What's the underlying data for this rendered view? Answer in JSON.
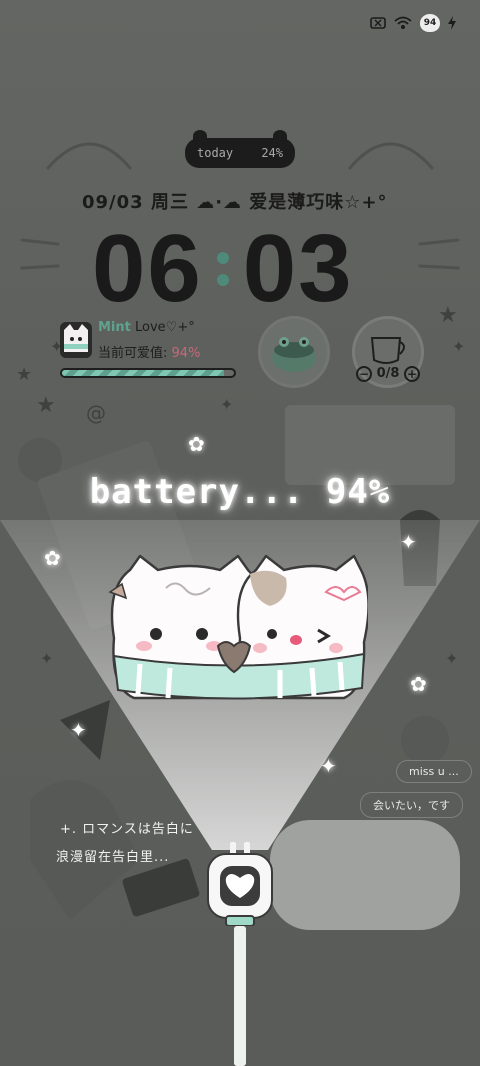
{
  "status_bar": {
    "icons": [
      "no-sim-icon",
      "wifi-icon",
      "battery-cat-icon",
      "charging-bolt-icon"
    ],
    "battery_level": "94"
  },
  "widget": {
    "today_label": "today",
    "today_percent": "24%",
    "date_line": "09/03 周三 ☁·☁ 爱是薄巧味☆+°",
    "time_hours": "06",
    "time_minutes": "03",
    "mint_name": "Mint",
    "mint_suffix": "Love♡+°",
    "cute_label": "当前可爱值:",
    "cute_value": "94%",
    "cute_progress": 0.94,
    "cup_count": "0/8"
  },
  "charging": {
    "text": "battery... 94%",
    "level": 0.94
  },
  "background_text": {
    "chip_1": "miss u ...",
    "chip_2": "会いたい，です",
    "romance_line_1": "+. ロマンスは告白に",
    "romance_line_2": "浪漫留在告白里..."
  },
  "colors": {
    "mint_accent": "#5ea38d",
    "pink_accent": "#c46a7a",
    "glow": "#ffffff"
  }
}
